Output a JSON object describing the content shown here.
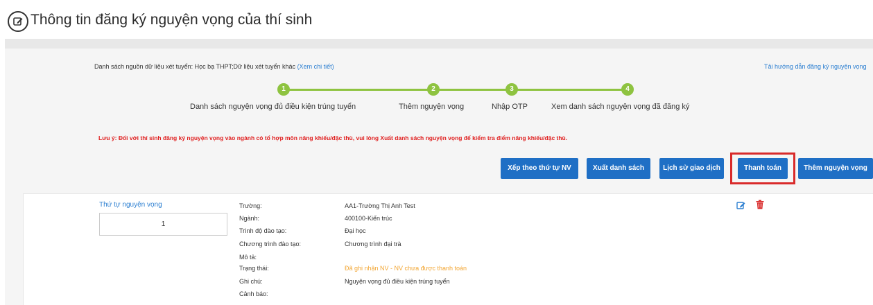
{
  "header": {
    "title": "Thông tin đăng ký nguyện vọng của thí sinh",
    "icon": "edit-circle-icon"
  },
  "source": {
    "text": "Danh sách nguồn dữ liệu xét tuyển: Học bạ THPT;Dữ liệu xét tuyển khác",
    "link": "(Xem chi tiết)"
  },
  "guide_link": "Tải hướng dẫn đăng ký nguyện vọng",
  "steps": [
    {
      "number": "1",
      "label": "Danh sách nguyện vọng đủ điều kiện trúng tuyển"
    },
    {
      "number": "2",
      "label": "Thêm nguyện vọng"
    },
    {
      "number": "3",
      "label": "Nhập OTP"
    },
    {
      "number": "4",
      "label": "Xem danh sách nguyện vọng đã đăng ký"
    }
  ],
  "warning": "Lưu ý: Đối với thí sinh đăng ký nguyện vọng vào ngành có tổ hợp môn năng khiếu/đặc thù, vui lòng Xuất danh sách nguyện vọng để kiểm tra điểm năng khiếu/đặc thù.",
  "buttons": {
    "sort": "Xếp theo thứ tự NV",
    "export": "Xuất danh sách",
    "history": "Lịch sử giao dịch",
    "pay": "Thanh toán",
    "add": "Thêm nguyện vọng"
  },
  "wish": {
    "order_label": "Thứ tự nguyện vọng",
    "order_value": "1",
    "fields": [
      {
        "label": "Trường:",
        "value": "AA1-Trường Thị Anh Test"
      },
      {
        "label": "Ngành:",
        "value": "400100-Kiến trúc"
      },
      {
        "label": "Trình độ đào tạo:",
        "value": "Đại học"
      },
      {
        "label": "Chương trình đào tạo:",
        "value": "Chương trình đại trà"
      },
      {
        "label": "Mô tả:",
        "value": ""
      },
      {
        "label": "Trạng thái:",
        "value": "Đã ghi nhận NV - NV chưa được thanh toán"
      },
      {
        "label": "Ghi chú:",
        "value": "Nguyện vọng đủ điều kiện trúng tuyển"
      },
      {
        "label": "Cảnh báo:",
        "value": ""
      }
    ]
  },
  "colors": {
    "primary_button": "#1f6fc5",
    "step_green": "#8ec340",
    "warning_red": "#e02020",
    "status_orange": "#f2a531",
    "highlight_red": "#d92a2a",
    "link_blue": "#2c7fd1"
  }
}
